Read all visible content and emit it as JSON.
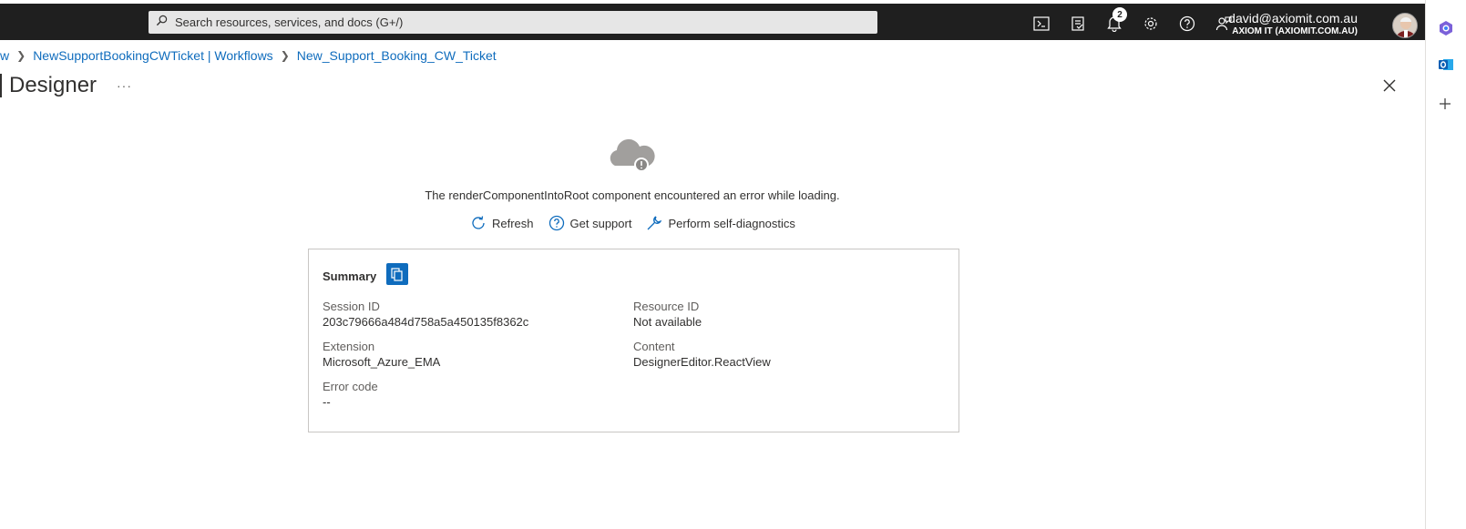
{
  "topbar": {
    "search_placeholder": "Search resources, services, and docs (G+/)",
    "notification_count": "2",
    "account_email": "david@axiomit.com.au",
    "account_tenant": "AXIOM IT (AXIOMIT.COM.AU)"
  },
  "breadcrumb": {
    "item0": "w",
    "item1": "NewSupportBookingCWTicket | Workflows",
    "item2": "New_Support_Booking_CW_Ticket"
  },
  "page": {
    "title": "Designer",
    "more_label": "···"
  },
  "error": {
    "message": "The renderComponentIntoRoot component encountered an error while loading.",
    "refresh_label": "Refresh",
    "support_label": "Get support",
    "diagnostics_label": "Perform self-diagnostics"
  },
  "summary": {
    "title": "Summary",
    "session_id_label": "Session ID",
    "session_id_value": "203c79666a484d758a5a450135f8362c",
    "resource_id_label": "Resource ID",
    "resource_id_value": "Not available",
    "extension_label": "Extension",
    "extension_value": "Microsoft_Azure_EMA",
    "content_label": "Content",
    "content_value": "DesignerEditor.ReactView",
    "error_code_label": "Error code",
    "error_code_value": "--"
  },
  "colors": {
    "topbar_bg": "#1f1f1f",
    "link": "#0f6cbd",
    "accent": "#0f6cbd"
  }
}
